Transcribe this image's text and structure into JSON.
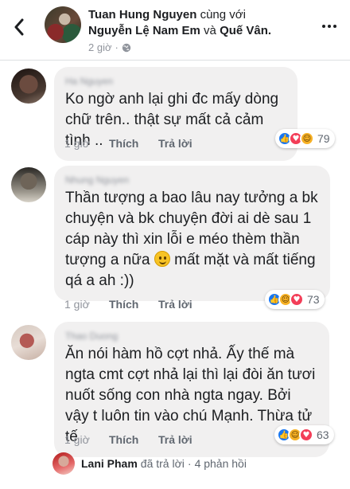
{
  "header": {
    "author": "Tuan Hung Nguyen",
    "with_label": "cùng với",
    "tagged1": "Nguyễn Lệ Nam Em",
    "and_label": "và",
    "tagged2": "Quế Vân.",
    "time": "2 giờ",
    "sep": "·"
  },
  "comments": [
    {
      "author": "Ha Nguyen",
      "text": "Ko ngờ anh lại ghi đc mấy dòng chữ trên.. thật sự mất cả cảm tình ..",
      "time": "1 giờ",
      "like_label": "Thích",
      "reply_label": "Trả lời",
      "reaction_count": "79"
    },
    {
      "author": "Nhung Nguyen",
      "text_before_emoji": "Thần tượng a bao lâu nay tưởng a bk chuyện và bk chuyện đời ai dè sau 1 cáp này thì xin lỗi e méo thèm thần tượng a nữa",
      "text_after_emoji": "mất mặt và mất tiếng qá a ah :))",
      "time": "1 giờ",
      "like_label": "Thích",
      "reply_label": "Trả lời",
      "reaction_count": "73"
    },
    {
      "author": "Thao Duong",
      "text": "Ăn nói hàm hồ cợt nhả. Ấy thế mà ngta cmt cợt nhả lại thì lại đòi ăn tươi nuốt sống con nhà ngta ngay. Bởi vậy t luôn tin vào chú Mạnh. Thừa tử tế",
      "time": "1 giờ",
      "like_label": "Thích",
      "reply_label": "Trả lời",
      "reaction_count": "63"
    }
  ],
  "reply_preview": {
    "name": "Lani Pham",
    "action": "đã trả lời",
    "sep": "·",
    "count": "4 phản hồi"
  },
  "colors": {
    "bubble": "#f1f0f0",
    "like_blue": "#1877f2",
    "love_red": "#f33e58",
    "haha_yellow": "#f7b125",
    "meta_grey": "#90949c"
  }
}
